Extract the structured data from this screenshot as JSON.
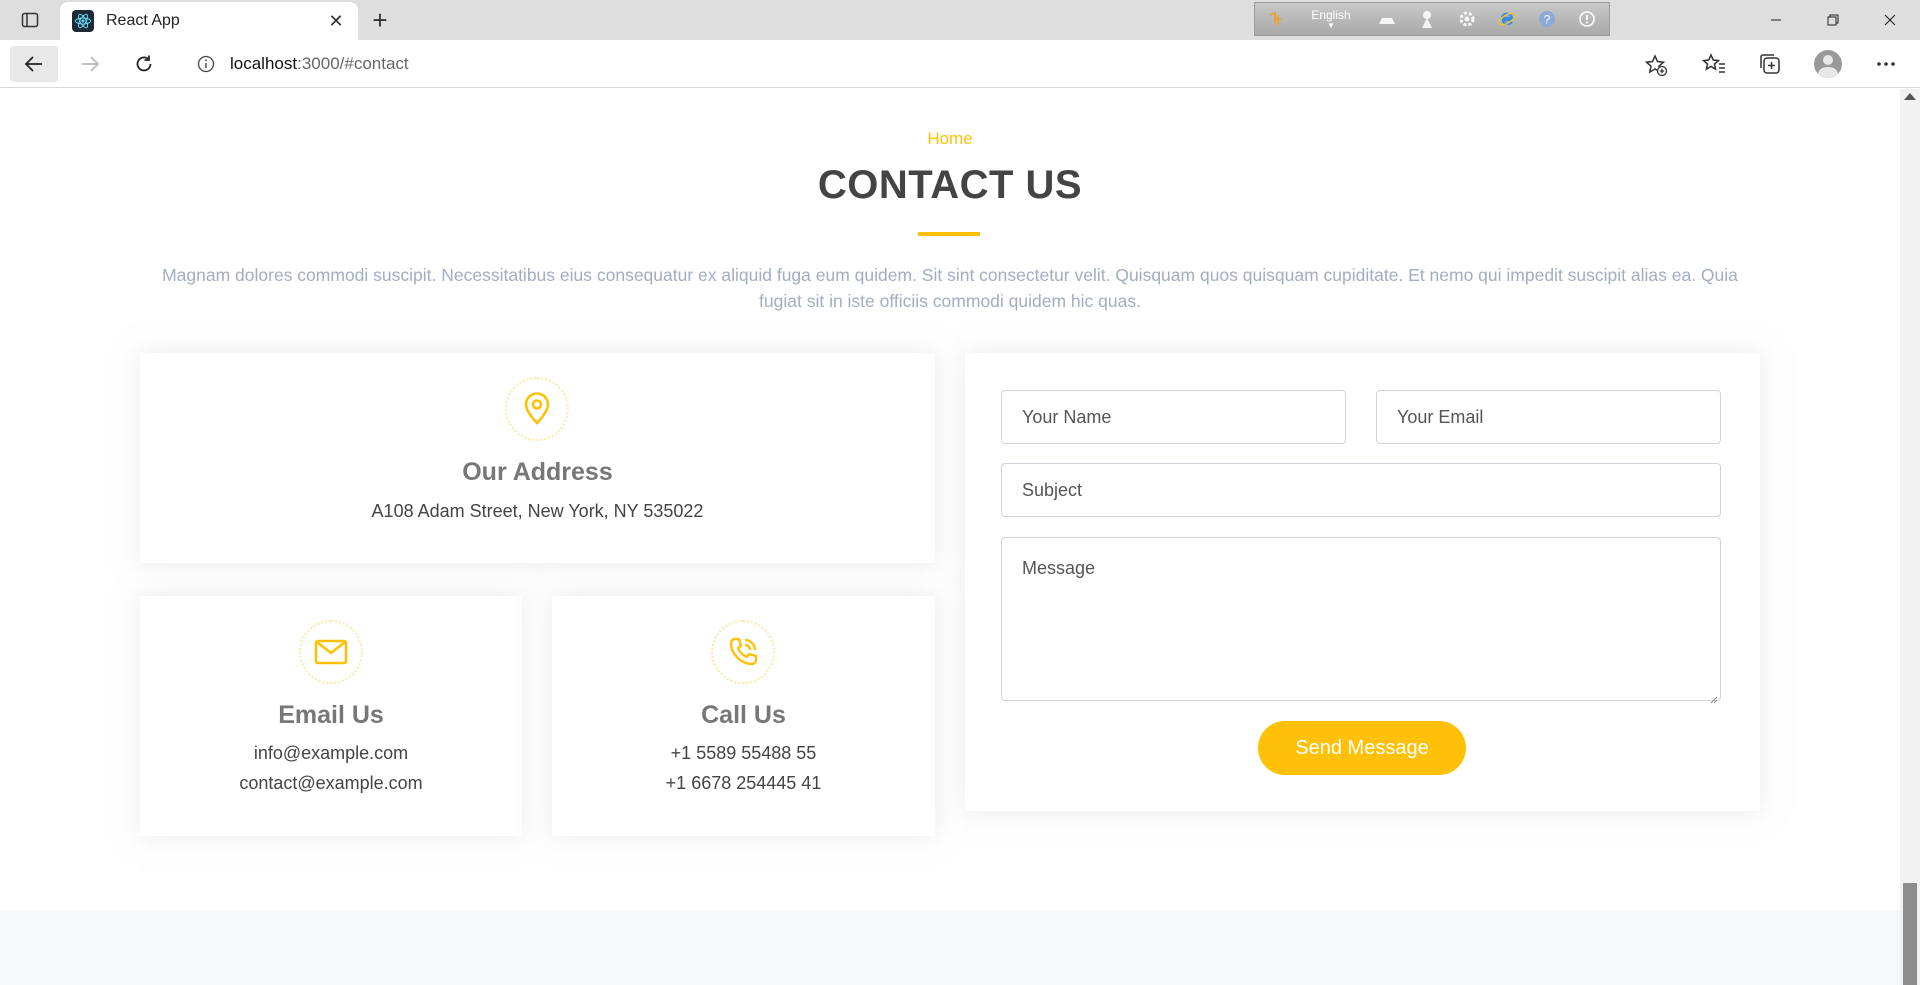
{
  "browser": {
    "tab_title": "React App",
    "url_host": "localhost",
    "url_path": ":3000/#contact",
    "extension_toolbar": {
      "language": "English"
    }
  },
  "page": {
    "breadcrumb": "Home",
    "title": "CONTACT US",
    "intro": "Magnam dolores commodi suscipit. Necessitatibus eius consequatur ex aliquid fuga eum quidem. Sit sint consectetur velit. Quisquam quos quisquam cupiditate. Et nemo qui impedit suscipit alias ea. Quia fugiat sit in iste officiis commodi quidem hic quas.",
    "accent_color": "#ffc107"
  },
  "address": {
    "icon": "map-pin-icon",
    "heading": "Our Address",
    "line": "A108 Adam Street, New York, NY 535022"
  },
  "email": {
    "icon": "envelope-icon",
    "heading": "Email Us",
    "line1": "info@example.com",
    "line2": "contact@example.com"
  },
  "call": {
    "icon": "phone-call-icon",
    "heading": "Call Us",
    "line1": "+1 5589 55488 55",
    "line2": "+1 6678 254445 41"
  },
  "form": {
    "name_placeholder": "Your Name",
    "email_placeholder": "Your Email",
    "subject_placeholder": "Subject",
    "message_placeholder": "Message",
    "submit_label": "Send Message"
  }
}
